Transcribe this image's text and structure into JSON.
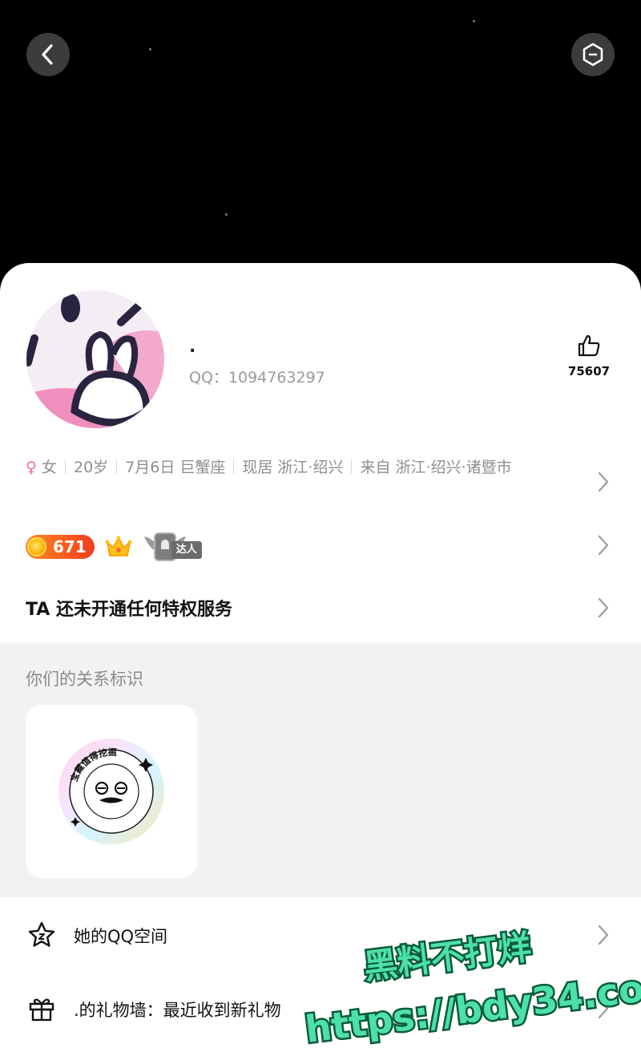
{
  "nav": {
    "back_icon": "chevron-left-icon",
    "more_icon": "hexagon-more-icon"
  },
  "profile": {
    "nickname": ".",
    "qq_number": "QQ：1094763297",
    "likes": {
      "icon": "thumbs-up-icon",
      "count": "75607"
    }
  },
  "info": {
    "gender_symbol": "♀",
    "gender": "女",
    "age": "20岁",
    "birthday": "7月6日 巨蟹座",
    "residence": "现居 浙江·绍兴",
    "hometown": "来自 浙江·绍兴·诸暨市"
  },
  "badges": {
    "level": "671",
    "talent_label": "达人"
  },
  "privilege": {
    "text": "TA 还未开通任何特权服务"
  },
  "relation": {
    "title": "你们的关系标识",
    "badge_arc_text": "宝藏值得挖掘"
  },
  "menu": [
    {
      "icon": "star-icon",
      "label": "她的QQ空间"
    },
    {
      "icon": "gift-icon",
      "label": ".的礼物墙：最近收到新礼物"
    }
  ],
  "watermark": {
    "line1": "黑料不打烊",
    "line2": "https://bdy34.co"
  },
  "colors": {
    "accent_pink": "#f06ea5",
    "level_orange": "#f23d1f",
    "chevron_gray": "#a0a0a0"
  }
}
